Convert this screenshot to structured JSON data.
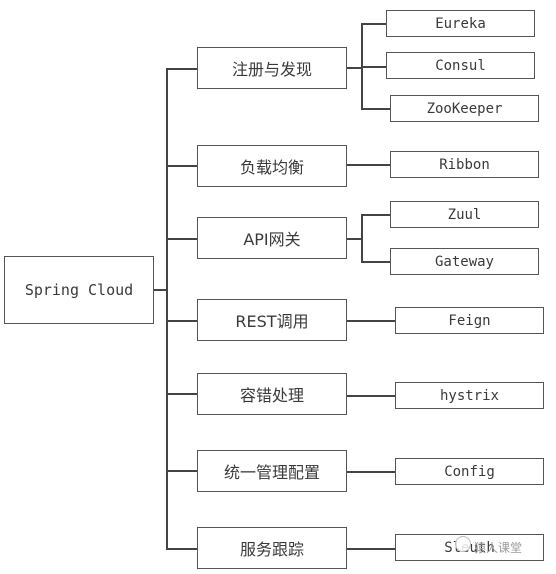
{
  "diagram": {
    "root": {
      "label": "Spring Cloud"
    },
    "categories": [
      {
        "label": "注册与发现",
        "children": [
          "Eureka",
          "Consul",
          "ZooKeeper"
        ]
      },
      {
        "label": "负载均衡",
        "children": [
          "Ribbon"
        ]
      },
      {
        "label": "API网关",
        "children": [
          "Zuul",
          "Gateway"
        ]
      },
      {
        "label": "REST调用",
        "children": [
          "Feign"
        ]
      },
      {
        "label": "容错处理",
        "children": [
          "hystrix"
        ]
      },
      {
        "label": "统一管理配置",
        "children": [
          "Config"
        ]
      },
      {
        "label": "服务跟踪",
        "children": [
          "Sleuth"
        ]
      }
    ]
  },
  "watermark": {
    "text": "猿人课堂"
  }
}
